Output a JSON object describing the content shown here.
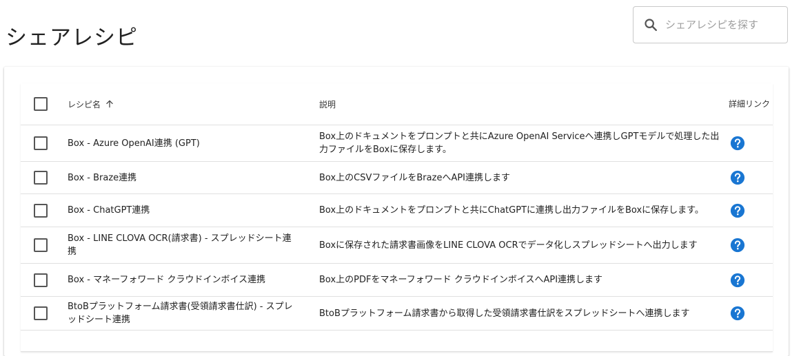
{
  "page": {
    "title": "シェアレシピ"
  },
  "search": {
    "placeholder": "シェアレシピを探す",
    "value": ""
  },
  "table": {
    "headers": {
      "name": "レシピ名",
      "description": "説明",
      "detail_link": "詳細リンク"
    },
    "sort": {
      "column": "name",
      "direction": "ascending"
    },
    "rows": [
      {
        "name": "Box - Azure OpenAI連携 (GPT)",
        "description": "Box上のドキュメントをプロンプトと共にAzure OpenAI Serviceへ連携しGPTモデルで処理した出力ファイルをBoxに保存します。",
        "checked": false
      },
      {
        "name": "Box - Braze連携",
        "description": "Box上のCSVファイルをBrazeへAPI連携します",
        "checked": false
      },
      {
        "name": "Box - ChatGPT連携",
        "description": "Box上のドキュメントをプロンプトと共にChatGPTに連携し出力ファイルをBoxに保存します。",
        "checked": false
      },
      {
        "name": "Box - LINE CLOVA OCR(請求書) - スプレッドシート連携",
        "description": "Boxに保存された請求書画像をLINE CLOVA OCRでデータ化しスプレッドシートへ出力します",
        "checked": false
      },
      {
        "name": "Box - マネーフォワード クラウドインボイス連携",
        "description": "Box上のPDFをマネーフォワード クラウドインボイスへAPI連携します",
        "checked": false
      },
      {
        "name": "BtoBプラットフォーム請求書(受領請求書仕訳) - スプレッドシート連携",
        "description": "BtoBプラットフォーム請求書から取得した受領請求書仕訳をスプレッドシートへ連携します",
        "checked": false
      }
    ]
  },
  "colors": {
    "accent": "#1976d2",
    "border": "#e0e0e0",
    "text": "#212121"
  },
  "icons": {
    "search": "search-icon",
    "sort": "arrow-up-icon",
    "help": "help-circle-icon"
  }
}
